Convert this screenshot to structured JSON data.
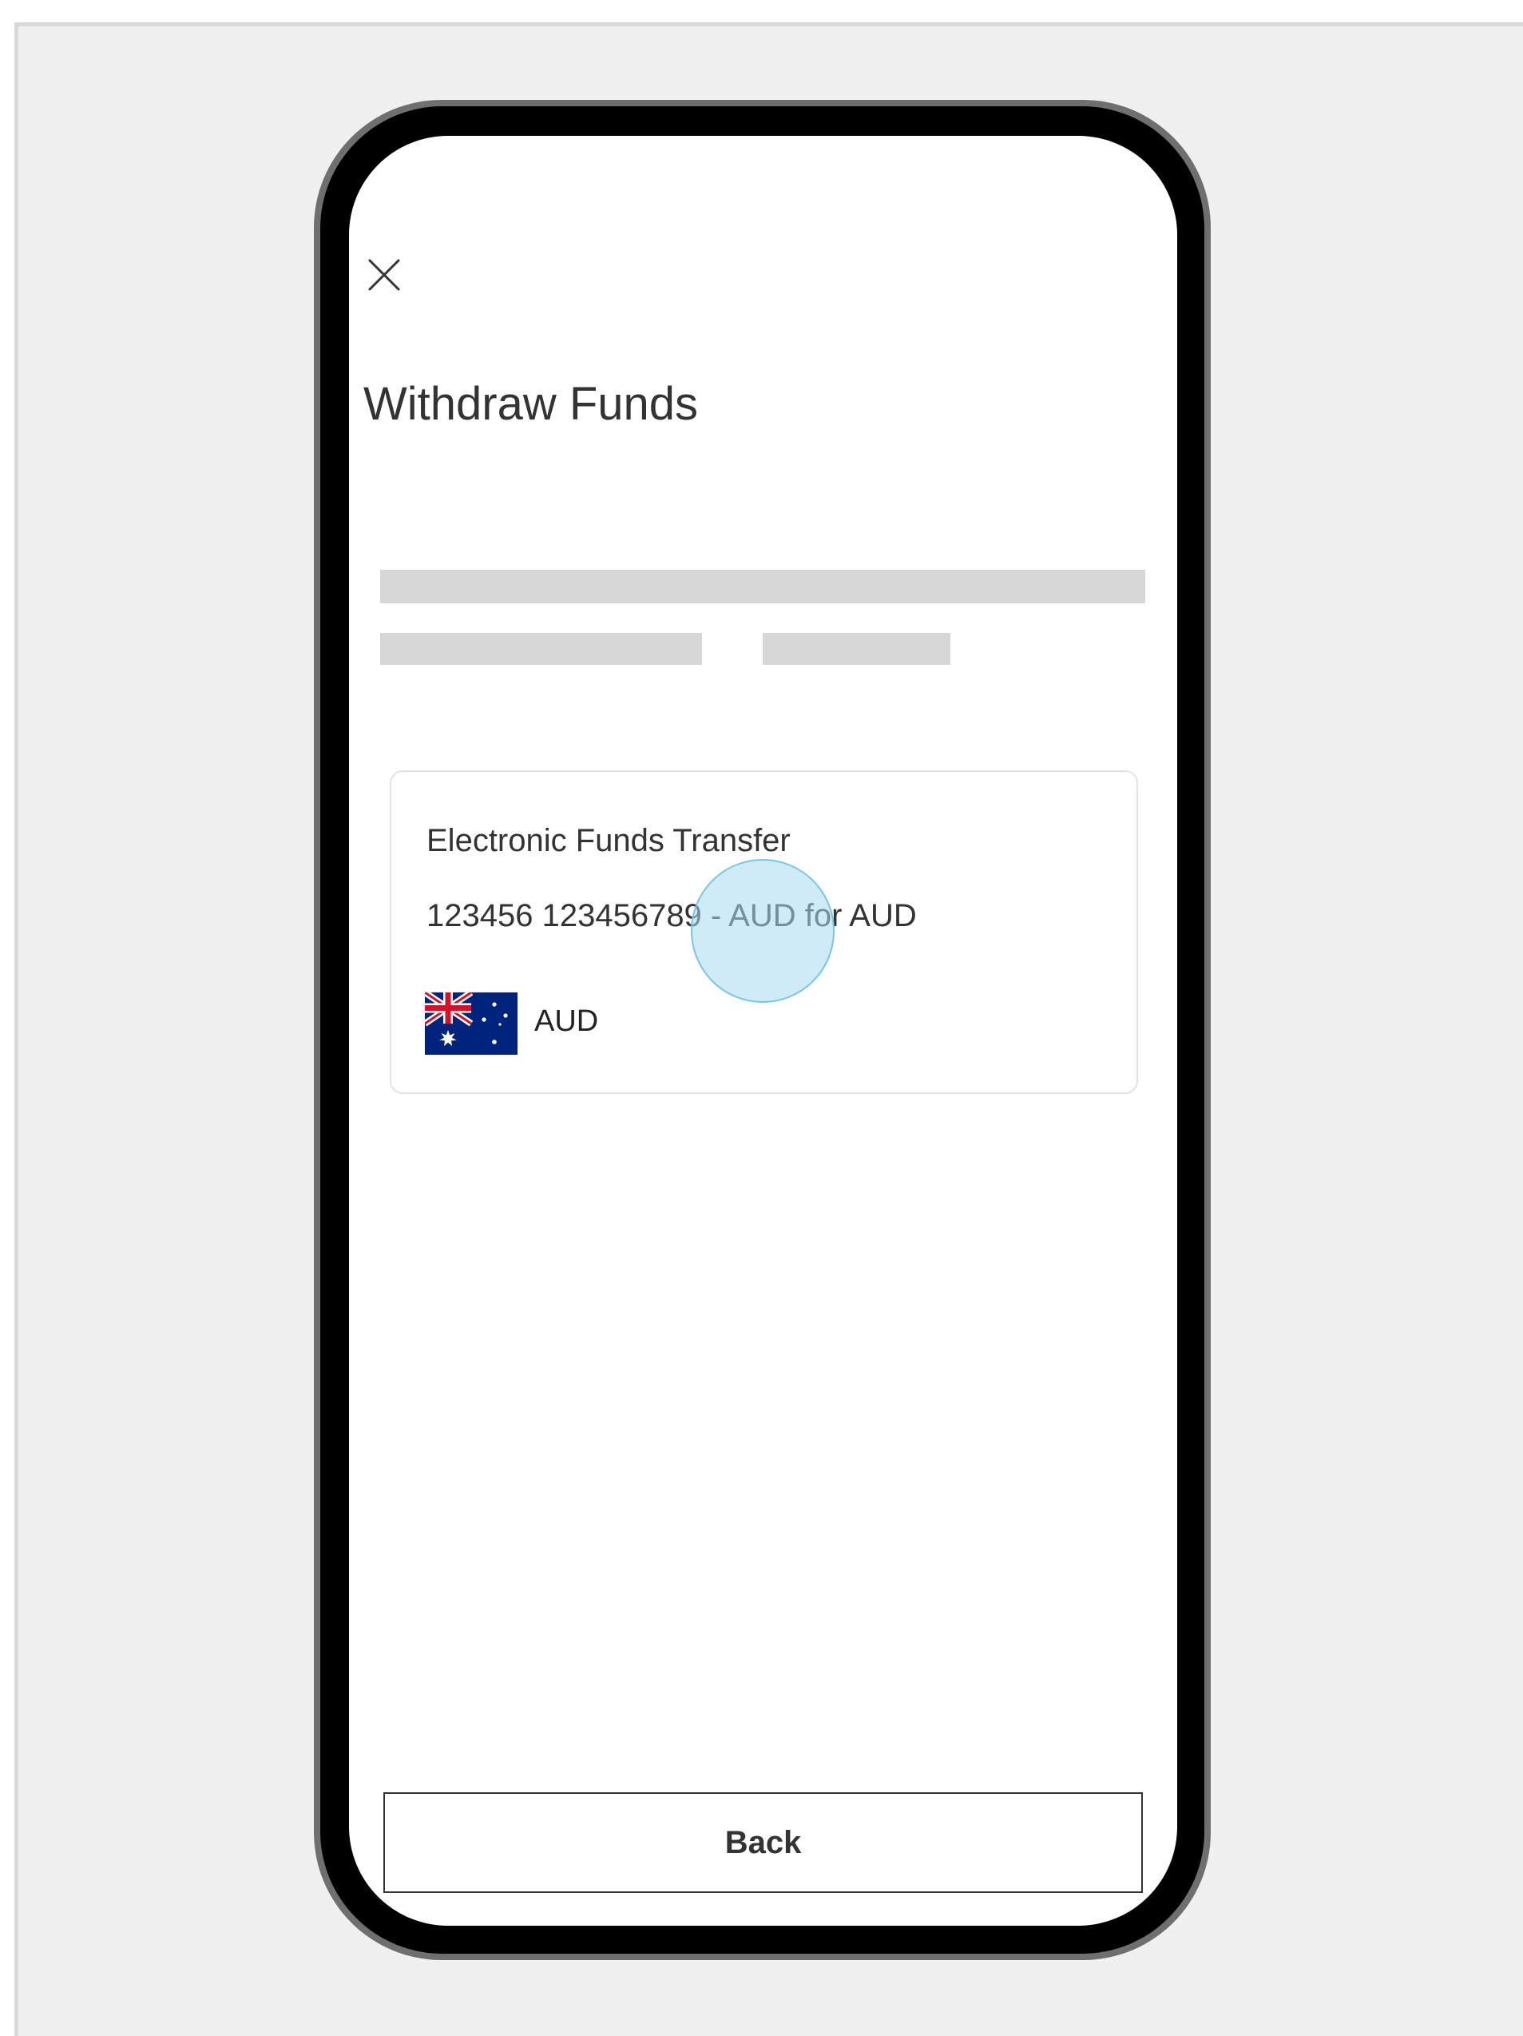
{
  "screen": {
    "close_icon": "close-icon",
    "title": "Withdraw Funds"
  },
  "payment_method": {
    "name": "Electronic Funds Transfer",
    "account": "123456 123456789 - AUD for AUD",
    "currency": "AUD",
    "flag_icon": "australia-flag-icon"
  },
  "footer": {
    "back_label": "Back"
  },
  "colors": {
    "background": "#f0f0f0",
    "phone_frame": "#000000",
    "text": "#333333",
    "skeleton": "#d7d7d7",
    "touch_indicator": "#a8daf0"
  }
}
